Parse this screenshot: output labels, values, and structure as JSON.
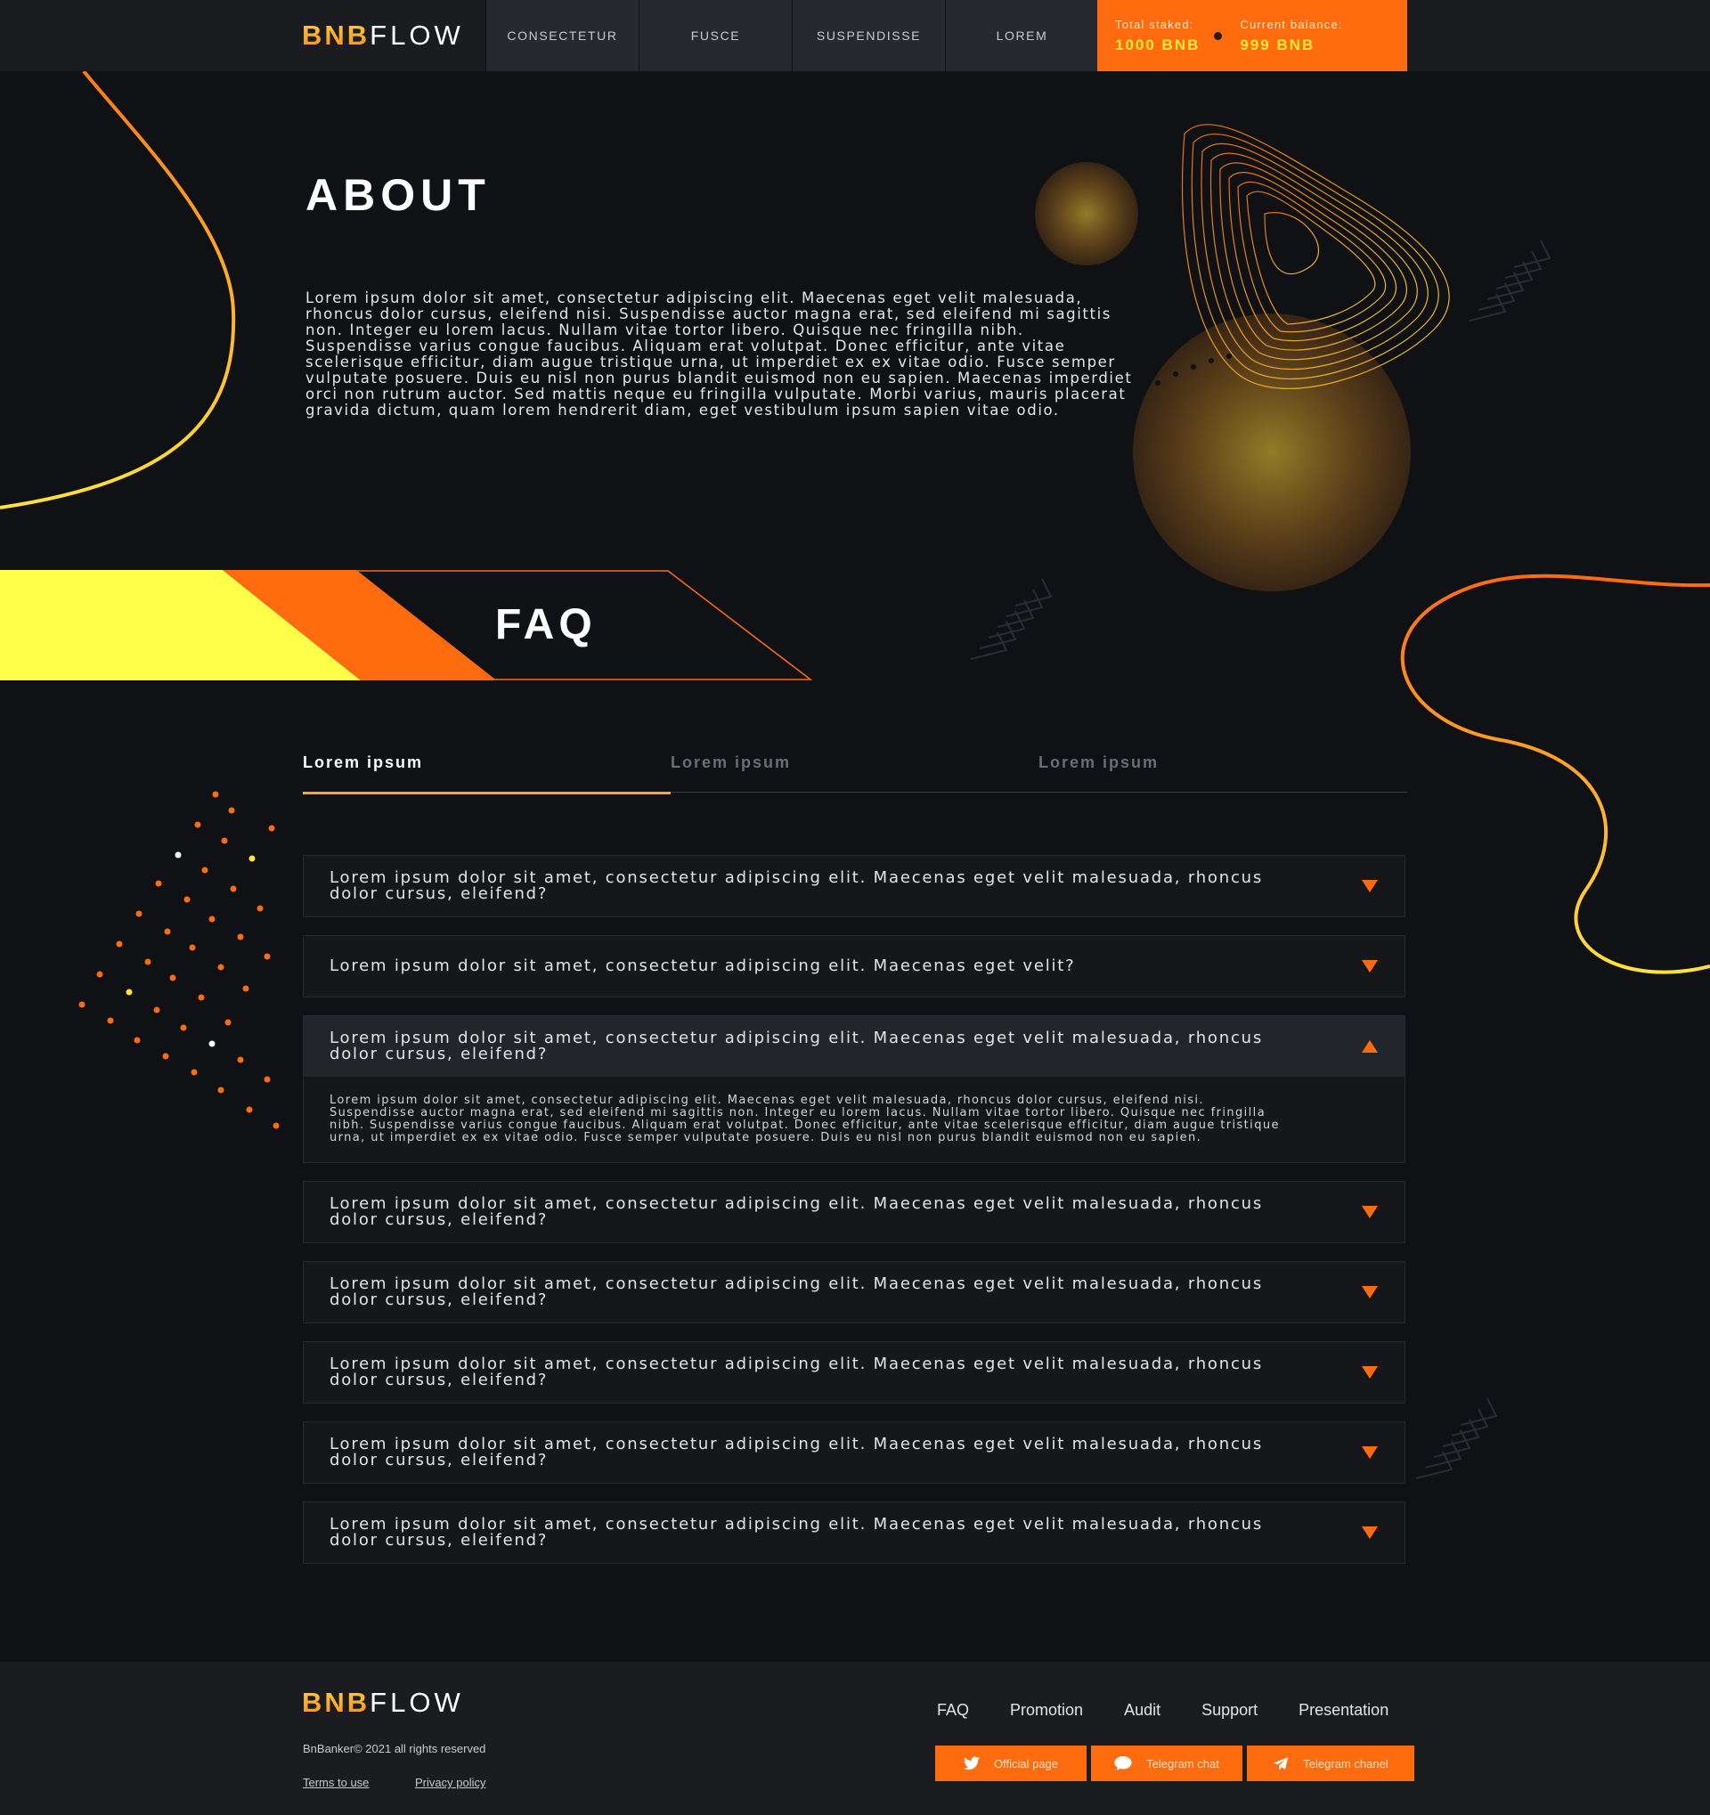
{
  "brand": {
    "logo_left": "BNB",
    "logo_right": "FLOW"
  },
  "colors": {
    "accent_orange": "#ff6b0f",
    "accent_yellow": "#ffff4a",
    "background": "#0f1114"
  },
  "nav": {
    "items": [
      "CONSECTETUR",
      "FUSCE",
      "SUSPENDISSE",
      "LOREM"
    ]
  },
  "stake": {
    "total_label": "Total staked:",
    "total_value": "1000 BNB",
    "balance_label": "Current balance:",
    "balance_value": "999 BNB"
  },
  "about": {
    "title": "ABOUT",
    "text": "Lorem ipsum dolor sit amet, consectetur adipiscing elit. Maecenas eget velit malesuada, rhoncus dolor cursus, eleifend nisi. Suspendisse auctor magna erat, sed eleifend mi sagittis non. Integer eu lorem lacus. Nullam vitae tortor libero. Quisque nec fringilla nibh. Suspendisse varius congue faucibus. Aliquam erat volutpat. Donec efficitur, ante vitae scelerisque efficitur, diam augue tristique urna, ut imperdiet ex ex vitae odio. Fusce semper vulputate posuere. Duis eu nisl non purus blandit euismod non eu sapien. Maecenas imperdiet orci non rutrum auctor. Sed mattis neque eu fringilla vulputate. Morbi varius, mauris placerat gravida dictum, quam lorem hendrerit diam, eget vestibulum ipsum sapien vitae odio."
  },
  "faq": {
    "title": "FAQ",
    "tabs": [
      "Lorem ipsum",
      "Lorem ipsum",
      "Lorem ipsum"
    ],
    "active_tab": 0,
    "items": [
      {
        "q": "Lorem ipsum dolor sit amet, consectetur adipiscing elit. Maecenas eget velit malesuada, rhoncus dolor cursus, eleifend?"
      },
      {
        "q": "Lorem ipsum dolor sit amet, consectetur adipiscing elit. Maecenas eget velit?"
      },
      {
        "q": "Lorem ipsum dolor sit amet, consectetur adipiscing elit. Maecenas eget velit malesuada, rhoncus dolor cursus, eleifend?",
        "a": "Lorem ipsum dolor sit amet, consectetur adipiscing elit. Maecenas eget velit malesuada, rhoncus dolor cursus, eleifend nisi. Suspendisse auctor magna erat, sed eleifend mi sagittis non. Integer eu lorem lacus. Nullam vitae tortor libero. Quisque nec fringilla nibh. Suspendisse varius congue faucibus. Aliquam erat volutpat. Donec efficitur, ante vitae scelerisque efficitur, diam augue tristique urna, ut imperdiet ex ex vitae odio. Fusce semper vulputate posuere. Duis eu nisl non purus blandit euismod non eu sapien.",
        "open": true
      },
      {
        "q": "Lorem ipsum dolor sit amet, consectetur adipiscing elit. Maecenas eget velit malesuada, rhoncus dolor cursus, eleifend?"
      },
      {
        "q": "Lorem ipsum dolor sit amet, consectetur adipiscing elit. Maecenas eget velit malesuada, rhoncus dolor cursus, eleifend?"
      },
      {
        "q": "Lorem ipsum dolor sit amet, consectetur adipiscing elit. Maecenas eget velit malesuada, rhoncus dolor cursus, eleifend?"
      },
      {
        "q": "Lorem ipsum dolor sit amet, consectetur adipiscing elit. Maecenas eget velit malesuada, rhoncus dolor cursus, eleifend?"
      },
      {
        "q": "Lorem ipsum dolor sit amet, consectetur adipiscing elit. Maecenas eget velit malesuada, rhoncus dolor cursus, eleifend?"
      }
    ]
  },
  "footer": {
    "copyright": "BnBanker© 2021 all rights reserved",
    "terms": "Terms to use",
    "privacy": "Privacy policy",
    "nav": [
      "FAQ",
      "Promotion",
      "Audit",
      "Support",
      "Presentation"
    ],
    "buttons": [
      {
        "label": "Official page",
        "icon": "twitter-icon"
      },
      {
        "label": "Telegram chat",
        "icon": "chat-bubble-icon"
      },
      {
        "label": "Telegram chanel",
        "icon": "paper-plane-icon"
      }
    ]
  }
}
